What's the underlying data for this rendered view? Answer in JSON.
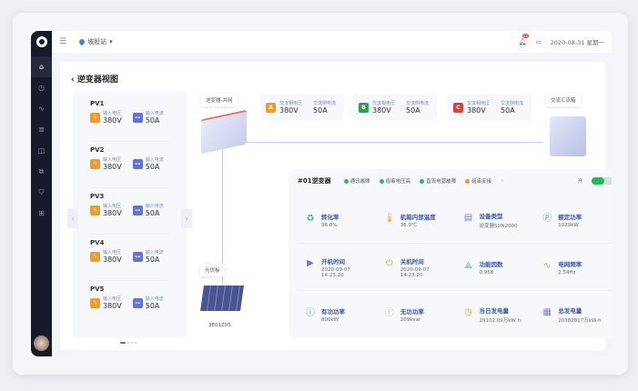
{
  "header": {
    "station": "坡股站",
    "notification_count": "13",
    "date": "2020-08-31 星期一"
  },
  "sidebar": {
    "icons": [
      "home-icon",
      "clock-icon",
      "trend-icon",
      "list-icon",
      "panel-icon",
      "devices-icon",
      "shield-icon",
      "grid-icon"
    ]
  },
  "page": {
    "title": "逆变器视图"
  },
  "pv_list": [
    {
      "name": "PV1",
      "voltage_label": "输入电压",
      "voltage": "380V",
      "current_label": "输入电流",
      "current": "50A"
    },
    {
      "name": "PV2",
      "voltage_label": "输入电压",
      "voltage": "380V",
      "current_label": "输入电流",
      "current": "50A"
    },
    {
      "name": "PV3",
      "voltage_label": "输入电压",
      "voltage": "380V",
      "current_label": "输入电流",
      "current": "50A"
    },
    {
      "name": "PV4",
      "voltage_label": "输入电压",
      "voltage": "380V",
      "current_label": "输入电流",
      "current": "50A"
    },
    {
      "name": "PV5",
      "voltage_label": "输入电压",
      "voltage": "380V",
      "current_label": "输入电流",
      "current": "50A"
    }
  ],
  "diagram": {
    "inverter_label": "逆变器-并网",
    "pv_board_label": "光伏板",
    "pv_board_id": "3E01Z05",
    "junction_label": "交流汇流箱"
  },
  "phases": [
    {
      "letter": "A",
      "color": "#f39a2b",
      "v_label": "交流相电压",
      "voltage": "380V",
      "c_label": "交流侧电流",
      "current": "50A"
    },
    {
      "letter": "B",
      "color": "#2ea44f",
      "v_label": "交流相电压",
      "voltage": "380V",
      "c_label": "交流侧电流",
      "current": "50A"
    },
    {
      "letter": "C",
      "color": "#d94040",
      "v_label": "交流相电压",
      "voltage": "380V",
      "c_label": "交流侧电流",
      "current": "50A"
    }
  ],
  "inverter": {
    "name": "#01逆变器",
    "statuses": [
      {
        "label": "通讯故障",
        "color": "#2ebd59"
      },
      {
        "label": "组串电压高",
        "color": "#2ebd59"
      },
      {
        "label": "直流电弧故障",
        "color": "#2ebd59"
      },
      {
        "label": "组串反接",
        "color": "#f39a2b"
      }
    ],
    "more": "»",
    "switch_label": "开",
    "switch_on": true,
    "metrics": [
      [
        {
          "k": "转化率",
          "v": "96.8%",
          "icon": "conversion-icon",
          "c": "#2ebd59",
          "g": "♻"
        },
        {
          "k": "机箱内部温度",
          "v": "36.9℃",
          "icon": "thermometer-icon",
          "c": "#f39a2b",
          "g": "🌡"
        },
        {
          "k": "设备类型",
          "v": "逆变器SUN2000",
          "icon": "device-type-icon",
          "c": "#7080d0",
          "g": "▤"
        },
        {
          "k": "额定功率",
          "v": "1029kW",
          "icon": "rated-power-icon",
          "c": "#5aa0e0",
          "g": "Ⓟ"
        }
      ],
      [
        {
          "k": "开机时间",
          "v": "2020-09-07\n14:23:20",
          "icon": "play-icon",
          "c": "#6a78e0",
          "g": "▶"
        },
        {
          "k": "关机时间",
          "v": "2020-09-07\n14:23:20",
          "icon": "power-icon",
          "c": "#f39a2b",
          "g": "⏻"
        },
        {
          "k": "功能因数",
          "v": "0.958",
          "icon": "factor-icon",
          "c": "#2ebd59",
          "g": "⟁"
        },
        {
          "k": "电网频率",
          "v": "2.54Hz",
          "icon": "frequency-icon",
          "c": "#f39a2b",
          "g": "∿"
        }
      ],
      [
        {
          "k": "有功功率",
          "v": "800kW",
          "icon": "active-power-icon",
          "c": "#2ebd59",
          "g": "ⓘ"
        },
        {
          "k": "无功功率",
          "v": "209kvar",
          "icon": "reactive-power-icon",
          "c": "#bbbbbb",
          "g": "ⓘ"
        },
        {
          "k": "当日发电量",
          "v": "29102.09万kW·h",
          "icon": "daily-energy-icon",
          "c": "#f39a2b",
          "g": "◷"
        },
        {
          "k": "总发电量",
          "v": "20382817万kW·h",
          "icon": "solar-panel-icon",
          "c": "#7080d0",
          "g": "▦"
        }
      ]
    ]
  }
}
